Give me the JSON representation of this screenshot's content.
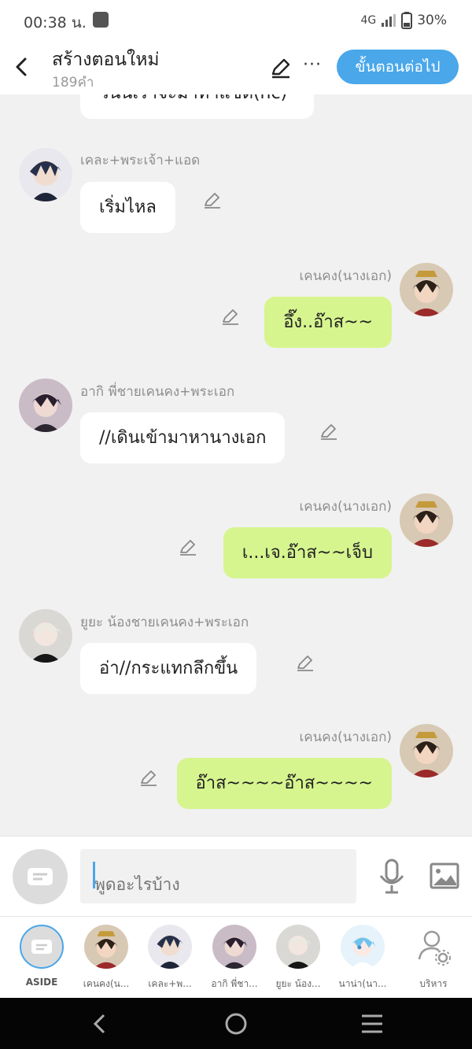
{
  "status_bar": {
    "time": "00:38 น.",
    "network": "4G",
    "battery": "30%"
  },
  "header": {
    "title": "สร้างตอนใหม่",
    "word_count": "189คำ",
    "next_button": "ขั้นตอนต่อไป"
  },
  "colors": {
    "accent": "#49a7ea",
    "right_bubble": "#d6f58f",
    "left_bubble": "#ffffff",
    "background": "#f1f1f1"
  },
  "messages": [
    {
      "side": "left",
      "speaker": "",
      "text": "วันนี้เราจะมาทำแชต(nc)"
    },
    {
      "side": "left",
      "speaker": "เคละ+พระเจ้า+แอด",
      "text": "เริ่มไหล"
    },
    {
      "side": "right",
      "speaker": "เคนคง(นางเอก)",
      "text": "อึ๊ง..อ๊าส~~"
    },
    {
      "side": "left",
      "speaker": "อากิ พี่ชายเคนคง+พระเอก",
      "text": "//เดินเข้ามาหานางเอก"
    },
    {
      "side": "right",
      "speaker": "เคนคง(นางเอก)",
      "text": "เ...เจ.อ๊าส~~เจ็บ"
    },
    {
      "side": "left",
      "speaker": "ยูยะ น้องชายเคนคง+พระเอก",
      "text": "อ่า//กระแทกลึกขึ้น"
    },
    {
      "side": "right",
      "speaker": "เคนคง(นางเอก)",
      "text": "อ๊าส~~~~อ๊าส~~~~"
    }
  ],
  "composer": {
    "placeholder": "พูดอะไรบ้าง"
  },
  "cast": [
    {
      "label": "ASIDE"
    },
    {
      "label": "เคนคง(น..."
    },
    {
      "label": "เคละ+พ..."
    },
    {
      "label": "อากิ พี่ชา..."
    },
    {
      "label": "ยูยะ น้อง..."
    },
    {
      "label": "นาน่า(นา..."
    },
    {
      "label": "บริหาร"
    }
  ],
  "icons": {
    "back": "chevron-left-icon",
    "edit": "pencil-icon",
    "more": "more-dots-icon",
    "mic": "microphone-icon",
    "image": "image-icon",
    "admin": "user-gear-icon"
  }
}
